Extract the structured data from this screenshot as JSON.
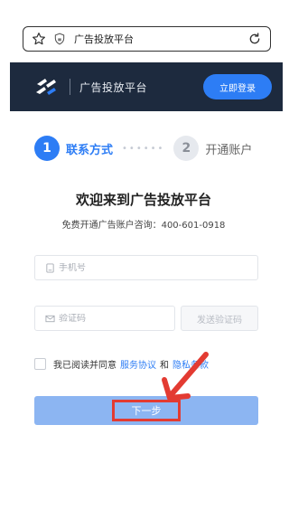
{
  "browser": {
    "url_text": "广告投放平台",
    "icons": {
      "star": "star-icon",
      "shield": "shield-icon",
      "reload": "reload-icon"
    }
  },
  "header": {
    "site_title": "广告投放平台",
    "login_label": "立即登录",
    "bg_color": "#1d2a3e",
    "accent_color": "#2d7df5"
  },
  "steps": [
    {
      "number": "1",
      "label": "联系方式",
      "active": true
    },
    {
      "number": "2",
      "label": "开通账户",
      "active": false
    }
  ],
  "form": {
    "welcome": "欢迎来到广告投放平台",
    "hotline": "免费开通广告账户咨询：400-601-0918",
    "phone_placeholder": "手机号",
    "code_placeholder": "验证码",
    "send_code_label": "发送验证码",
    "agree_prefix": "我已阅读并同意",
    "service_link": "服务协议",
    "and_text": "和",
    "privacy_link": "隐私条款",
    "next_label": "下一步",
    "next_button_color": "#8cb5f2"
  },
  "annotation": {
    "highlight_color": "#e33b32"
  }
}
